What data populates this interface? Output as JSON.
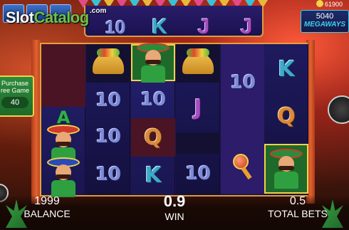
{
  "logo": {
    "text_main": "Slot",
    "text_accent": "Catalog",
    "suffix": ".com"
  },
  "top_row": {
    "symbols": [
      "10",
      "K",
      "J",
      "J"
    ]
  },
  "jackpot": {
    "value": "61900"
  },
  "megaways": {
    "count": "5040",
    "label": "MEGAWAYS"
  },
  "purchase_panel": {
    "line1": "Purchase",
    "line2": "ree Game",
    "price": "40"
  },
  "reels": [
    {
      "symbols": [
        "",
        "",
        "A",
        "mariachi",
        "mariachi"
      ]
    },
    {
      "symbols": [
        "taco",
        "10",
        "10",
        "10"
      ]
    },
    {
      "symbols": [
        "mariachi",
        "10",
        "Q",
        "K"
      ]
    },
    {
      "symbols": [
        "taco",
        "J",
        "",
        "10"
      ]
    },
    {
      "symbols": [
        "10",
        "",
        "maraca",
        ""
      ]
    },
    {
      "symbols": [
        "K",
        "Q",
        "mariachi"
      ]
    }
  ],
  "footer": {
    "balance_value": "1999",
    "balance_label": "BALANCE",
    "win_value": "0.9",
    "win_label": "WIN",
    "bet_value": "0.5",
    "bet_label": "TOTAL BETS"
  }
}
